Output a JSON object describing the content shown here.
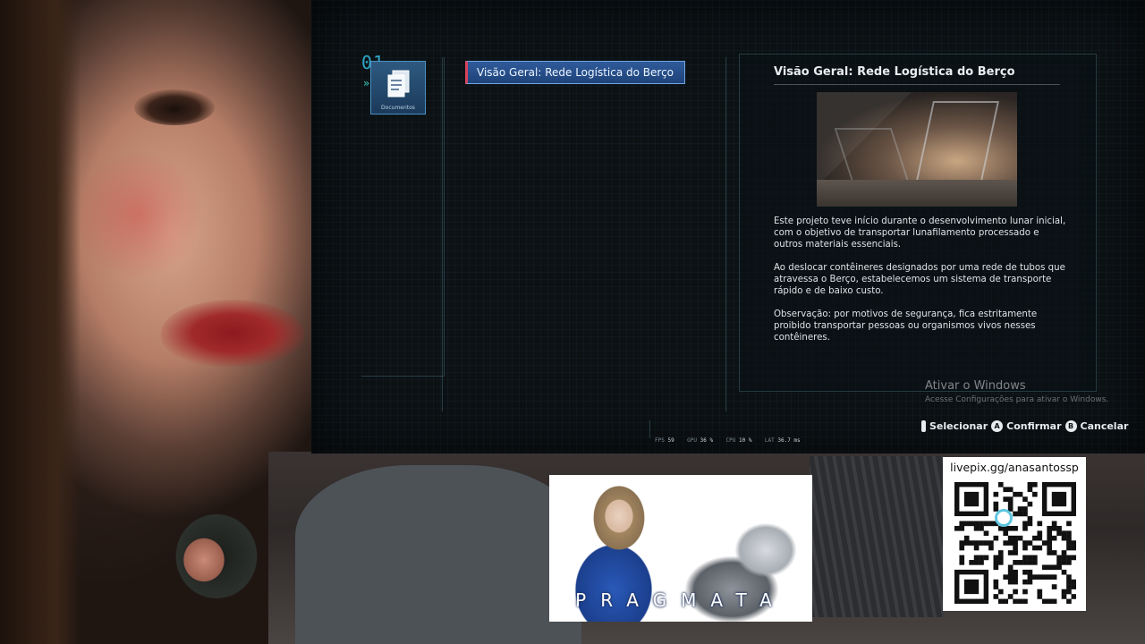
{
  "game": {
    "category_number": "01",
    "category_label": "Documentos",
    "list_selected": "Visão Geral: Rede Logística do Berço",
    "detail_title": "Visão Geral: Rede Logística do Berço",
    "paragraphs": [
      "Este projeto teve início durante o desenvolvimento lunar inicial, com o objetivo de transportar lunafilamento processado e outros materiais essenciais.",
      "Ao deslocar contêineres designados por uma rede de tubos que atravessa o Berço, estabelecemos um sistema de transporte rápido e de baixo custo.",
      "Observação: por motivos de segurança, fica estritamente proibido transportar pessoas ou organismos vivos nesses contêineres."
    ],
    "stats": {
      "fps_label": "FPS",
      "fps_value": "59",
      "gpu_label": "GPU",
      "gpu_value": "36 %",
      "cpu_label": "CPU",
      "cpu_value": "10 %",
      "lat_label": "LAT",
      "lat_value": "36.7 ms"
    },
    "prompts": {
      "select": "Selecionar",
      "confirm_btn": "A",
      "confirm": "Confirmar",
      "cancel_btn": "B",
      "cancel": "Cancelar"
    }
  },
  "windows_watermark": {
    "title": "Ativar o Windows",
    "subtitle": "Acesse Configurações para ativar o Windows."
  },
  "overlays": {
    "pragmata_logo": "PRAGMATA",
    "qr_url": "livepix.gg/anasantossp"
  },
  "colors": {
    "accent_blue": "#2f5a9a",
    "highlight_red": "#d6435a",
    "qr_center": "#5fc6e0"
  }
}
